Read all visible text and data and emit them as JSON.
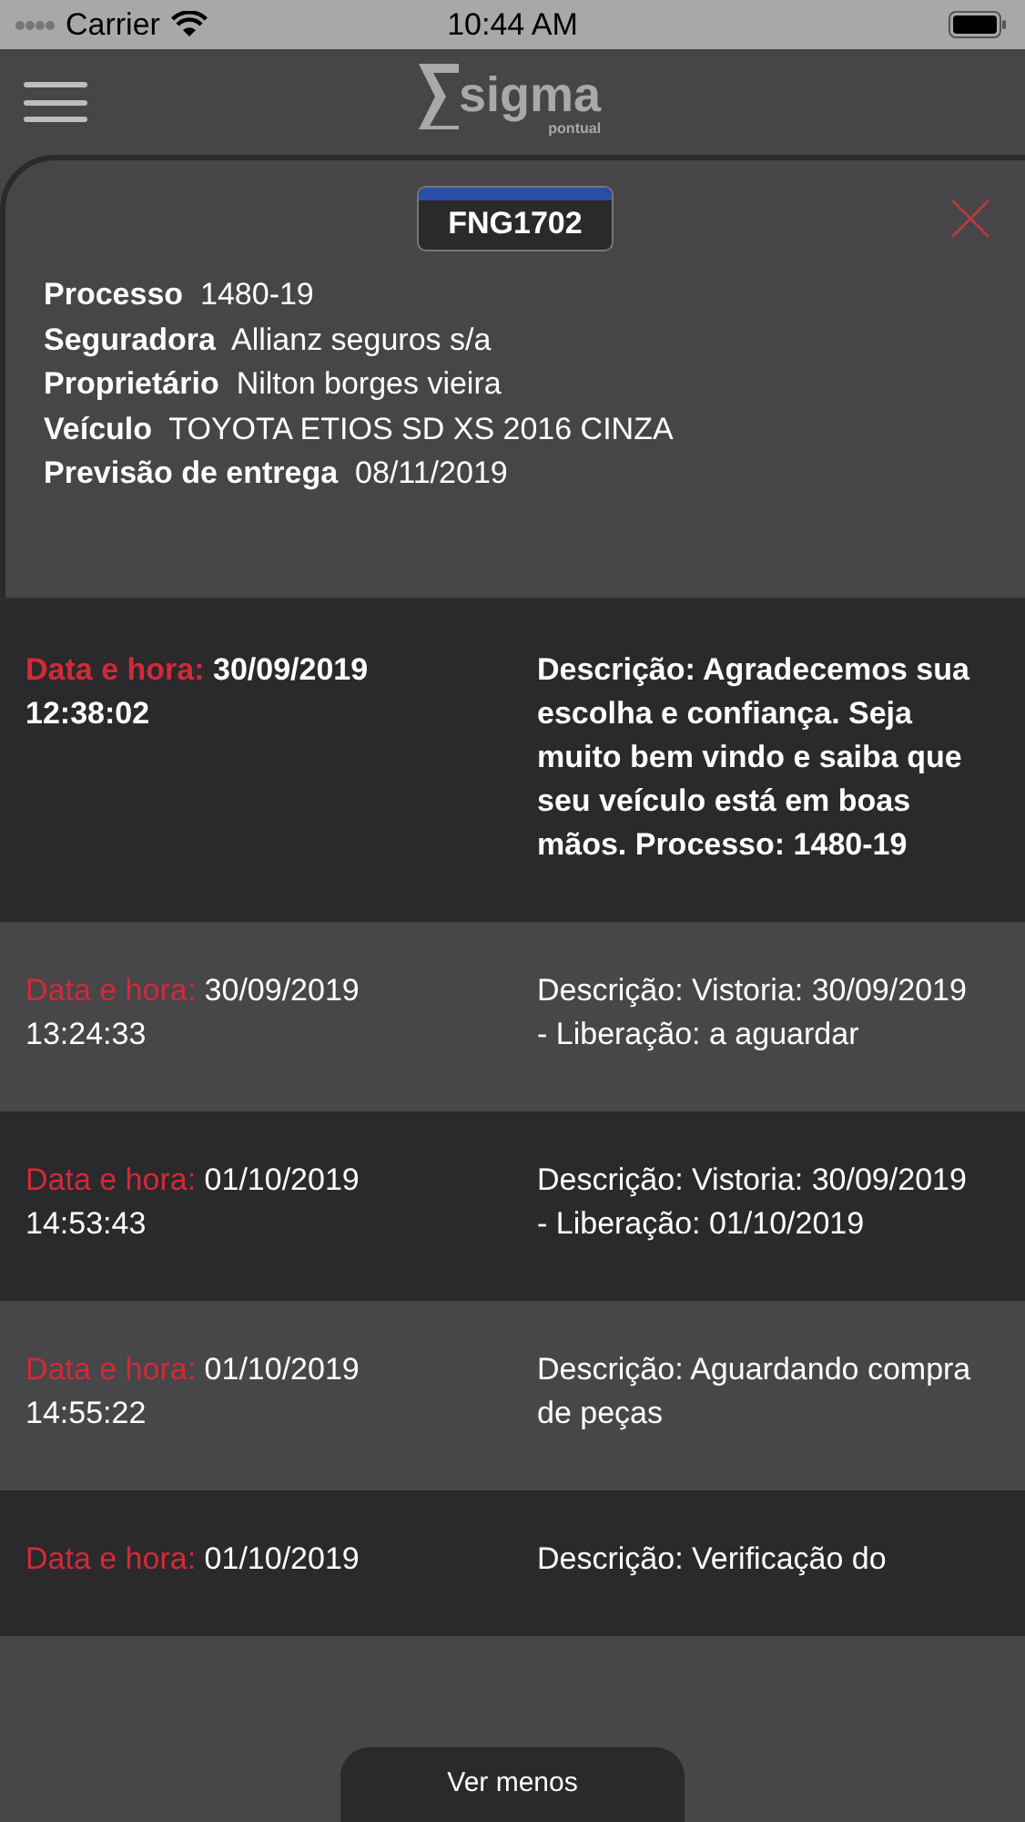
{
  "status_bar": {
    "carrier": "Carrier",
    "time": "10:44 AM"
  },
  "header": {
    "logo_name": "sigma",
    "logo_tagline": "pontual"
  },
  "vehicle": {
    "plate": "FNG1702",
    "fields": [
      {
        "label": "Processo",
        "value": "1480-19"
      },
      {
        "label": "Seguradora",
        "value": "Allianz seguros s/a"
      },
      {
        "label": "Proprietário",
        "value": "Nilton borges vieira"
      },
      {
        "label": "Veículo",
        "value": "TOYOTA ETIOS SD XS 2016 CINZA"
      },
      {
        "label": "Previsão de entrega",
        "value": "08/11/2019"
      }
    ]
  },
  "events": [
    {
      "date_label": "Data e hora:",
      "datetime": "30/09/2019 12:38:02",
      "description": "Descrição: Agradecemos sua escolha e confiança. Seja muito bem vindo e saiba que seu veículo está em boas mãos. Processo: 1480-19",
      "highlighted": true
    },
    {
      "date_label": "Data e hora:",
      "datetime": "30/09/2019 13:24:33",
      "description": "Descrição: Vistoria: 30/09/2019 - Liberação: a aguardar",
      "highlighted": false
    },
    {
      "date_label": "Data e hora:",
      "datetime": "01/10/2019 14:53:43",
      "description": "Descrição: Vistoria: 30/09/2019 - Liberação: 01/10/2019",
      "highlighted": false
    },
    {
      "date_label": "Data e hora:",
      "datetime": "01/10/2019 14:55:22",
      "description": "Descrição: Aguardando compra de peças",
      "highlighted": false
    },
    {
      "date_label": "Data e hora:",
      "datetime": "01/10/2019",
      "description": "Descrição: Verificação do",
      "highlighted": false
    }
  ],
  "footer": {
    "button": "Ver menos"
  }
}
